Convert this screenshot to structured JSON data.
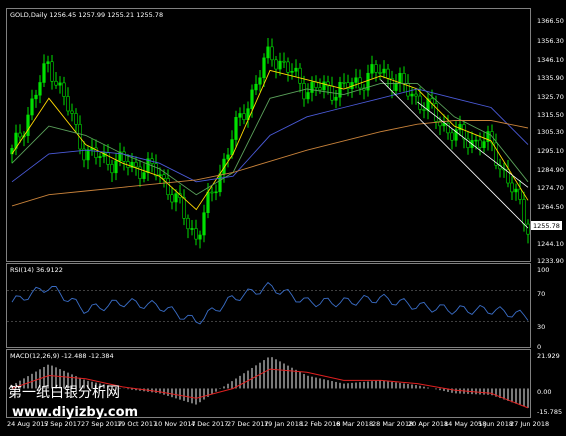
{
  "symbol_header": "GOLD,Daily  1256.45 1257.99 1255.21 1255.78",
  "rsi_header": "RSI(14) 36.9122",
  "macd_header": "MACD(12,26,9) -12.488 -12.384",
  "price_axis": [
    "1366.50",
    "1356.30",
    "1346.10",
    "1335.90",
    "1325.70",
    "1315.50",
    "1305.30",
    "1295.10",
    "1284.90",
    "1274.70",
    "1264.50",
    "1244.10",
    "1233.90"
  ],
  "current_price": "1255.78",
  "rsi_axis": [
    "100",
    "70",
    "30",
    "0"
  ],
  "macd_axis": [
    "21.929",
    "0.00",
    "-15.785"
  ],
  "date_axis": [
    "24 Aug 2017",
    "5 Sep 2017",
    "27 Sep 2017",
    "19 Oct 2017",
    "10 Nov 2017",
    "4 Dec 2017",
    "27 Dec 2017",
    "19 Jan 2018",
    "12 Feb 2018",
    "6 Mar 2018",
    "28 Mar 2018",
    "20 Apr 2018",
    "14 May 2018",
    "5 Jun 2018",
    "27 Jun 2018"
  ],
  "watermark": {
    "cn": "第一纸白银分析网",
    "url": "www.diyizby.com"
  },
  "colors": {
    "background": "#000000",
    "bull_candle": "#00e000",
    "ma_fast": "#ffd800",
    "ma_mid": "#5aa05a",
    "ma_slow": "#4a5ad8",
    "ma_200": "#c8823a",
    "trendline": "#ffffff",
    "rsi_line": "#3a6ec8",
    "macd_hist": "#c8c8c8",
    "macd_signal": "#e02020"
  },
  "chart_data": {
    "type": "line",
    "title": "GOLD,Daily",
    "ohlc_last": {
      "open": 1256.45,
      "high": 1257.99,
      "low": 1255.21,
      "close": 1255.78
    },
    "x": [
      "24 Aug 2017",
      "5 Sep 2017",
      "27 Sep 2017",
      "19 Oct 2017",
      "10 Nov 2017",
      "4 Dec 2017",
      "27 Dec 2017",
      "19 Jan 2018",
      "12 Feb 2018",
      "6 Mar 2018",
      "28 Mar 2018",
      "20 Apr 2018",
      "14 May 2018",
      "5 Jun 2018",
      "27 Jun 2018"
    ],
    "series": [
      {
        "values": [
          1290,
          1340,
          1290,
          1285,
          1280,
          1245,
          1300,
          1345,
          1325,
          1325,
          1335,
          1320,
          1300,
          1295,
          1252
        ]
      },
      {
        "values": [
          1290,
          1320,
          1295,
          1285,
          1278,
          1260,
          1290,
          1335,
          1330,
          1325,
          1332,
          1325,
          1305,
          1297,
          1265
        ]
      },
      {
        "values": [
          1285,
          1305,
          1300,
          1290,
          1282,
          1268,
          1280,
          1320,
          1325,
          1322,
          1328,
          1328,
          1310,
          1300,
          1275
        ]
      },
      {
        "values": [
          1275,
          1290,
          1292,
          1290,
          1285,
          1275,
          1278,
          1300,
          1310,
          1315,
          1320,
          1325,
          1320,
          1315,
          1295
        ]
      },
      {
        "values": [
          1262,
          1268,
          1270,
          1272,
          1274,
          1276,
          1280,
          1286,
          1292,
          1297,
          1302,
          1306,
          1308,
          1308,
          1304
        ]
      }
    ],
    "ylim": [
      1233.9,
      1366.5
    ],
    "rsi": {
      "values": [
        55,
        75,
        45,
        55,
        50,
        30,
        60,
        75,
        55,
        55,
        60,
        50,
        45,
        45,
        37
      ],
      "ylim": [
        0,
        100
      ],
      "levels": [
        70,
        30
      ]
    },
    "macd": {
      "histogram": [
        2,
        15,
        5,
        0,
        -3,
        -10,
        5,
        20,
        8,
        3,
        5,
        2,
        -3,
        -4,
        -12
      ],
      "signal": [
        0,
        8,
        6,
        1,
        -2,
        -6,
        0,
        12,
        10,
        5,
        5,
        3,
        -1,
        -3,
        -12
      ],
      "ylim": [
        -15.785,
        21.929
      ]
    }
  }
}
